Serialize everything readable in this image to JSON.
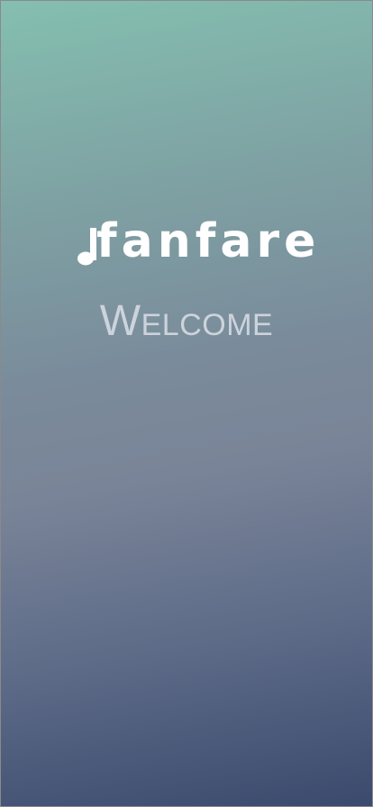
{
  "brand": {
    "name": "fanfare"
  },
  "welcome": {
    "label": "Welcome"
  },
  "colors": {
    "gradient_top": "#84bfb0",
    "gradient_mid": "#7a8498",
    "gradient_bottom": "#3b4a6d",
    "logo": "#ffffff",
    "welcome_text": "#cdd3dc"
  }
}
